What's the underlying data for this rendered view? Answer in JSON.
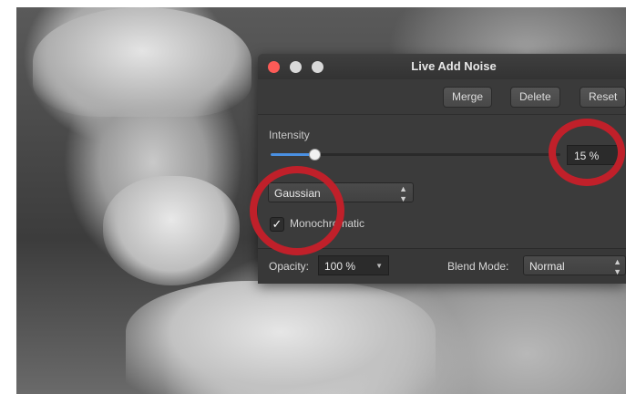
{
  "window": {
    "title": "Live Add Noise"
  },
  "toolbar": {
    "merge_label": "Merge",
    "delete_label": "Delete",
    "reset_label": "Reset"
  },
  "intensity": {
    "label": "Intensity",
    "value_text": "15 %",
    "value": 0.15
  },
  "noise_type": {
    "selected": "Gaussian"
  },
  "monochromatic": {
    "label": "Monochromatic",
    "checked_glyph": "✓"
  },
  "bottom": {
    "opacity_label": "Opacity:",
    "opacity_value": "100 %",
    "blend_label": "Blend Mode:",
    "blend_value": "Normal"
  },
  "colors": {
    "annotation_red": "#c0202a",
    "slider_accent": "#4a90e2",
    "close_button": "#fc5b57"
  }
}
